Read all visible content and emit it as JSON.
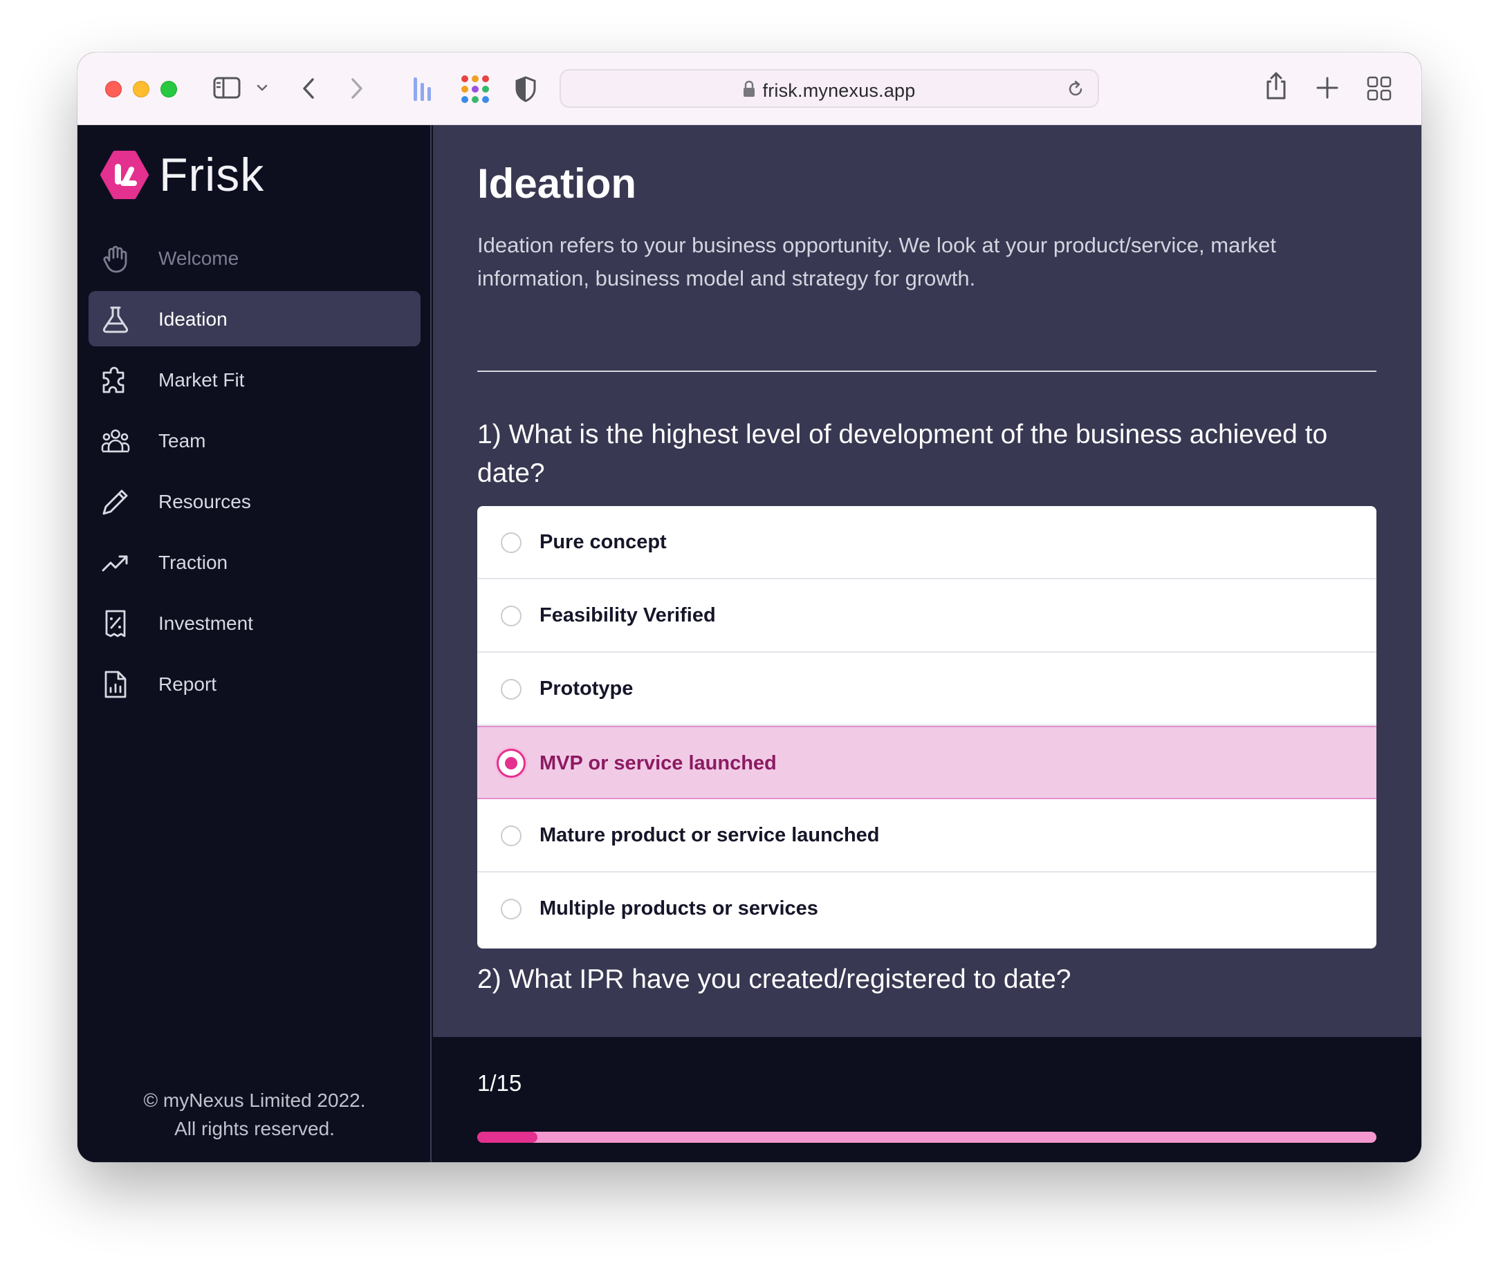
{
  "browser": {
    "url": "frisk.mynexus.app"
  },
  "brand": {
    "name": "Frisk",
    "accent": "#e4308f"
  },
  "sidebar": {
    "items": [
      {
        "label": "Welcome",
        "icon": "hand-icon"
      },
      {
        "label": "Ideation",
        "icon": "flask-icon"
      },
      {
        "label": "Market Fit",
        "icon": "puzzle-icon"
      },
      {
        "label": "Team",
        "icon": "users-icon"
      },
      {
        "label": "Resources",
        "icon": "pencil-icon"
      },
      {
        "label": "Traction",
        "icon": "trending-up-icon"
      },
      {
        "label": "Investment",
        "icon": "receipt-percent-icon"
      },
      {
        "label": "Report",
        "icon": "document-chart-icon"
      }
    ],
    "active_index": 1,
    "copyright_line1": "© myNexus Limited 2022.",
    "copyright_line2": "All rights reserved."
  },
  "main": {
    "title": "Ideation",
    "description": "Ideation refers to your business opportunity. We look at your product/service, market information, business model and strategy for growth.",
    "questions": [
      {
        "text": "1) What is the highest level of development of the business achieved to date?",
        "options": [
          "Pure concept",
          "Feasibility Verified",
          "Prototype",
          "MVP or service launched",
          "Mature product or service launched",
          "Multiple products or services"
        ],
        "selected_index": 3
      },
      {
        "text": "2) What IPR have you created/registered to date?"
      }
    ]
  },
  "progress": {
    "label": "1/15",
    "current": 1,
    "total": 15
  }
}
